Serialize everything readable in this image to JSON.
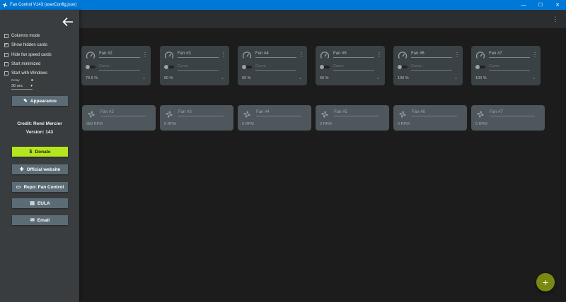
{
  "window": {
    "title": "Fan Control V143 (userConfig.json)"
  },
  "sidebar": {
    "options": [
      {
        "label": "Columns mode",
        "checked": false
      },
      {
        "label": "Show hidden cards",
        "checked": true
      },
      {
        "label": "Hide fan speed cards",
        "checked": false
      },
      {
        "label": "Start minimized",
        "checked": false
      },
      {
        "label": "Start with Windows",
        "checked": false
      }
    ],
    "delay": {
      "label": "Delay",
      "value": "30 sec"
    },
    "appearance_label": "Appearance",
    "credit": "Credit: Remi Mercier",
    "version": "Version: 143",
    "buttons": {
      "donate": "Donate",
      "website": "Official website",
      "repo": "Repo: Fan Control",
      "eula": "EULA",
      "email": "Email"
    }
  },
  "control_cards": [
    {
      "name": "Fan #2",
      "curve": "Curve",
      "value": "79.6 %"
    },
    {
      "name": "Fan #3",
      "curve": "Curve",
      "value": "60 %"
    },
    {
      "name": "Fan #4",
      "curve": "Curve",
      "value": "60 %"
    },
    {
      "name": "Fan #5",
      "curve": "Curve",
      "value": "60 %"
    },
    {
      "name": "Fan #6",
      "curve": "Curve",
      "value": "100 %"
    },
    {
      "name": "Fan #7",
      "curve": "Curve",
      "value": "100 %"
    }
  ],
  "speed_cards": [
    {
      "name": "Fan #2",
      "value": "983 RPM"
    },
    {
      "name": "Fan #3",
      "value": "0 RPM"
    },
    {
      "name": "Fan #4",
      "value": "0 RPM"
    },
    {
      "name": "Fan #5",
      "value": "0 RPM"
    },
    {
      "name": "Fan #6",
      "value": "0 RPM"
    },
    {
      "name": "Fan #7",
      "value": "0 RPM"
    }
  ],
  "fab_label": "+",
  "colors": {
    "accent": "#0078d7",
    "donate": "#b5e61d",
    "fab": "#7a8a10"
  }
}
